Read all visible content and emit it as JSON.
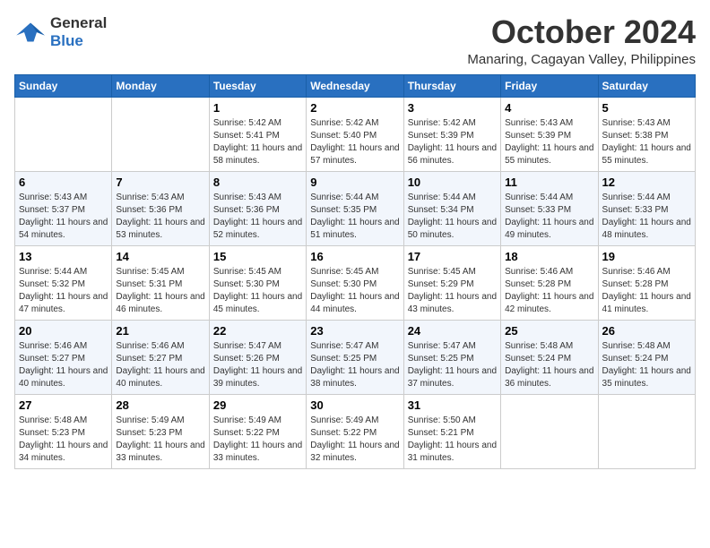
{
  "logo": {
    "line1": "General",
    "line2": "Blue"
  },
  "title": "October 2024",
  "location": "Manaring, Cagayan Valley, Philippines",
  "days_header": [
    "Sunday",
    "Monday",
    "Tuesday",
    "Wednesday",
    "Thursday",
    "Friday",
    "Saturday"
  ],
  "weeks": [
    [
      {
        "day": "",
        "text": ""
      },
      {
        "day": "",
        "text": ""
      },
      {
        "day": "1",
        "text": "Sunrise: 5:42 AM\nSunset: 5:41 PM\nDaylight: 11 hours and 58 minutes."
      },
      {
        "day": "2",
        "text": "Sunrise: 5:42 AM\nSunset: 5:40 PM\nDaylight: 11 hours and 57 minutes."
      },
      {
        "day": "3",
        "text": "Sunrise: 5:42 AM\nSunset: 5:39 PM\nDaylight: 11 hours and 56 minutes."
      },
      {
        "day": "4",
        "text": "Sunrise: 5:43 AM\nSunset: 5:39 PM\nDaylight: 11 hours and 55 minutes."
      },
      {
        "day": "5",
        "text": "Sunrise: 5:43 AM\nSunset: 5:38 PM\nDaylight: 11 hours and 55 minutes."
      }
    ],
    [
      {
        "day": "6",
        "text": "Sunrise: 5:43 AM\nSunset: 5:37 PM\nDaylight: 11 hours and 54 minutes."
      },
      {
        "day": "7",
        "text": "Sunrise: 5:43 AM\nSunset: 5:36 PM\nDaylight: 11 hours and 53 minutes."
      },
      {
        "day": "8",
        "text": "Sunrise: 5:43 AM\nSunset: 5:36 PM\nDaylight: 11 hours and 52 minutes."
      },
      {
        "day": "9",
        "text": "Sunrise: 5:44 AM\nSunset: 5:35 PM\nDaylight: 11 hours and 51 minutes."
      },
      {
        "day": "10",
        "text": "Sunrise: 5:44 AM\nSunset: 5:34 PM\nDaylight: 11 hours and 50 minutes."
      },
      {
        "day": "11",
        "text": "Sunrise: 5:44 AM\nSunset: 5:33 PM\nDaylight: 11 hours and 49 minutes."
      },
      {
        "day": "12",
        "text": "Sunrise: 5:44 AM\nSunset: 5:33 PM\nDaylight: 11 hours and 48 minutes."
      }
    ],
    [
      {
        "day": "13",
        "text": "Sunrise: 5:44 AM\nSunset: 5:32 PM\nDaylight: 11 hours and 47 minutes."
      },
      {
        "day": "14",
        "text": "Sunrise: 5:45 AM\nSunset: 5:31 PM\nDaylight: 11 hours and 46 minutes."
      },
      {
        "day": "15",
        "text": "Sunrise: 5:45 AM\nSunset: 5:30 PM\nDaylight: 11 hours and 45 minutes."
      },
      {
        "day": "16",
        "text": "Sunrise: 5:45 AM\nSunset: 5:30 PM\nDaylight: 11 hours and 44 minutes."
      },
      {
        "day": "17",
        "text": "Sunrise: 5:45 AM\nSunset: 5:29 PM\nDaylight: 11 hours and 43 minutes."
      },
      {
        "day": "18",
        "text": "Sunrise: 5:46 AM\nSunset: 5:28 PM\nDaylight: 11 hours and 42 minutes."
      },
      {
        "day": "19",
        "text": "Sunrise: 5:46 AM\nSunset: 5:28 PM\nDaylight: 11 hours and 41 minutes."
      }
    ],
    [
      {
        "day": "20",
        "text": "Sunrise: 5:46 AM\nSunset: 5:27 PM\nDaylight: 11 hours and 40 minutes."
      },
      {
        "day": "21",
        "text": "Sunrise: 5:46 AM\nSunset: 5:27 PM\nDaylight: 11 hours and 40 minutes."
      },
      {
        "day": "22",
        "text": "Sunrise: 5:47 AM\nSunset: 5:26 PM\nDaylight: 11 hours and 39 minutes."
      },
      {
        "day": "23",
        "text": "Sunrise: 5:47 AM\nSunset: 5:25 PM\nDaylight: 11 hours and 38 minutes."
      },
      {
        "day": "24",
        "text": "Sunrise: 5:47 AM\nSunset: 5:25 PM\nDaylight: 11 hours and 37 minutes."
      },
      {
        "day": "25",
        "text": "Sunrise: 5:48 AM\nSunset: 5:24 PM\nDaylight: 11 hours and 36 minutes."
      },
      {
        "day": "26",
        "text": "Sunrise: 5:48 AM\nSunset: 5:24 PM\nDaylight: 11 hours and 35 minutes."
      }
    ],
    [
      {
        "day": "27",
        "text": "Sunrise: 5:48 AM\nSunset: 5:23 PM\nDaylight: 11 hours and 34 minutes."
      },
      {
        "day": "28",
        "text": "Sunrise: 5:49 AM\nSunset: 5:23 PM\nDaylight: 11 hours and 33 minutes."
      },
      {
        "day": "29",
        "text": "Sunrise: 5:49 AM\nSunset: 5:22 PM\nDaylight: 11 hours and 33 minutes."
      },
      {
        "day": "30",
        "text": "Sunrise: 5:49 AM\nSunset: 5:22 PM\nDaylight: 11 hours and 32 minutes."
      },
      {
        "day": "31",
        "text": "Sunrise: 5:50 AM\nSunset: 5:21 PM\nDaylight: 11 hours and 31 minutes."
      },
      {
        "day": "",
        "text": ""
      },
      {
        "day": "",
        "text": ""
      }
    ]
  ]
}
